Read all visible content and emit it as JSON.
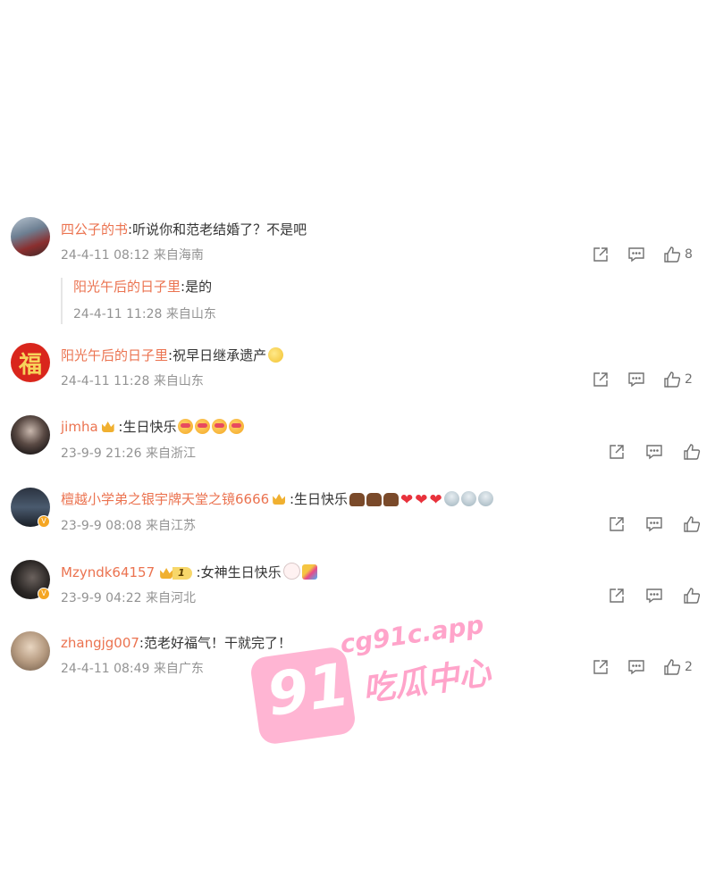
{
  "comments": [
    {
      "user": "四公子的书",
      "text": ":听说你和范老结婚了？不是吧",
      "meta": "24-4-11 08:12 来自海南",
      "likes": "8",
      "reply": {
        "user": "阳光午后的日子里",
        "text": ":是的",
        "meta": "24-4-11 11:28 来自山东"
      }
    },
    {
      "user": "阳光午后的日子里",
      "text": ":祝早日继承遗产",
      "meta": "24-4-11 11:28 来自山东",
      "likes": "2",
      "avatar_char": "福"
    },
    {
      "user": "jimha",
      "text": " :生日快乐",
      "meta": "23-9-9 21:26 来自浙江",
      "likes": ""
    },
    {
      "user": "檀越小学弟之银宇牌天堂之镜6666",
      "text": " :生日快乐",
      "meta": "23-9-9 08:08 来自江苏",
      "likes": ""
    },
    {
      "user": "Mzyndk64157",
      "vip_level": "1",
      "text": " :女神生日快乐",
      "meta": "23-9-9 04:22 来自河北",
      "likes": ""
    },
    {
      "user": "zhangjg007",
      "text": ":范老好福气！干就完了！",
      "meta": "24-4-11 08:49 来自广东",
      "likes": "2"
    }
  ],
  "icons": [
    "share-icon",
    "comment-icon",
    "like-icon",
    "crown-icon",
    "verified-icon"
  ],
  "watermark": {
    "number": "91",
    "url": "cg91c.app",
    "cn": "吃瓜中心"
  },
  "colors": {
    "username": "#eb7350",
    "meta": "#939393",
    "icon": "#707070",
    "watermark": "#ff5aa0"
  }
}
